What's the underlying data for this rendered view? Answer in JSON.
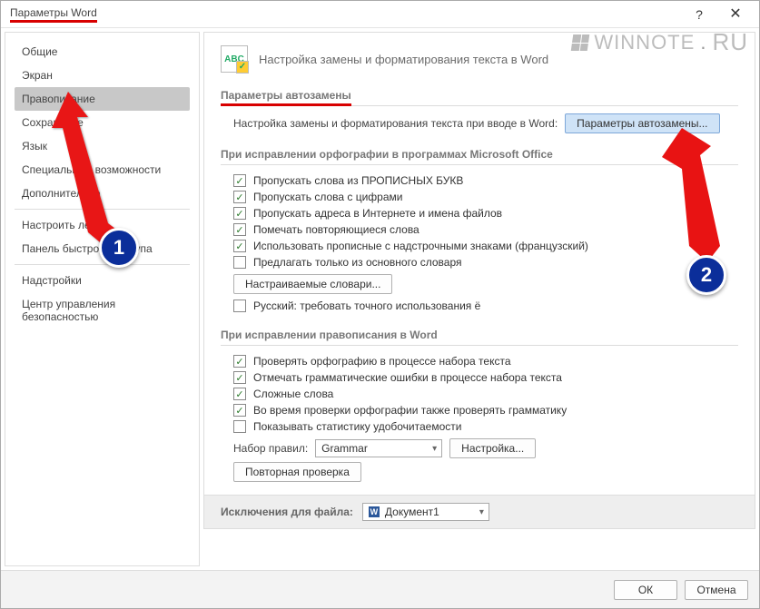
{
  "titlebar": {
    "title": "Параметры Word"
  },
  "watermark": {
    "text": "WINNOTE",
    "suffix": "RU"
  },
  "sidebar": {
    "items": [
      {
        "label": "Общие",
        "selected": false
      },
      {
        "label": "Экран",
        "selected": false
      },
      {
        "label": "Правописание",
        "selected": true
      },
      {
        "label": "Сохранение",
        "selected": false
      },
      {
        "label": "Язык",
        "selected": false
      },
      {
        "label": "Специальные возможности",
        "selected": false
      },
      {
        "label": "Дополнительно",
        "selected": false
      }
    ],
    "items2": [
      {
        "label": "Настроить ленту"
      },
      {
        "label": "Панель быстрого доступа"
      }
    ],
    "items3": [
      {
        "label": "Надстройки"
      },
      {
        "label": "Центр управления безопасностью"
      }
    ]
  },
  "heading": {
    "icon_label": "ABC",
    "text": "Настройка замены и форматирования текста в Word"
  },
  "section_autocorrect": {
    "title": "Параметры автозамены",
    "row_label": "Настройка замены и форматирования текста при вводе в Word:",
    "button": "Параметры автозамены..."
  },
  "section_spell_office": {
    "title": "При исправлении орфографии в программах Microsoft Office",
    "checks": [
      {
        "checked": true,
        "label": "Пропускать слова из ПРОПИСНЫХ БУКВ"
      },
      {
        "checked": true,
        "label": "Пропускать слова с цифрами"
      },
      {
        "checked": true,
        "label": "Пропускать адреса в Интернете и имена файлов"
      },
      {
        "checked": true,
        "label": "Помечать повторяющиеся слова"
      },
      {
        "checked": true,
        "label": "Использовать прописные с надстрочными знаками (французский)"
      },
      {
        "checked": false,
        "label": "Предлагать только из основного словаря"
      }
    ],
    "custom_dict_btn": "Настраиваемые словари...",
    "check_russian_yo": {
      "checked": false,
      "label": "Русский: требовать точного использования ё"
    }
  },
  "section_spell_word": {
    "title": "При исправлении правописания в Word",
    "checks": [
      {
        "checked": true,
        "label": "Проверять орфографию в процессе набора текста"
      },
      {
        "checked": true,
        "label": "Отмечать грамматические ошибки в процессе набора текста"
      },
      {
        "checked": true,
        "label": "Сложные слова"
      },
      {
        "checked": true,
        "label": "Во время проверки орфографии также проверять грамматику"
      },
      {
        "checked": false,
        "label": "Показывать статистику удобочитаемости"
      }
    ],
    "ruleset_label": "Набор правил:",
    "ruleset_value": "Grammar",
    "ruleset_settings_btn": "Настройка...",
    "recheck_btn": "Повторная проверка"
  },
  "section_exceptions": {
    "label": "Исключения для файла:",
    "value": "Документ1"
  },
  "footer": {
    "ok": "ОК",
    "cancel": "Отмена"
  },
  "annotations": {
    "c1": "1",
    "c2": "2"
  }
}
